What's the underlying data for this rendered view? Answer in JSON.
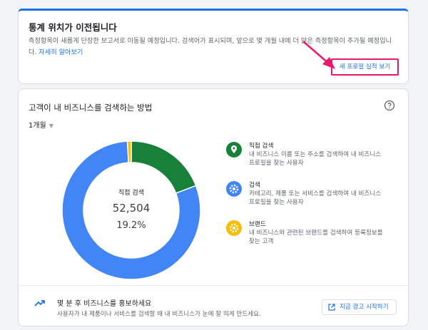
{
  "notice": {
    "title": "통계 위치가 이전됩니다",
    "body": "측정항목이 새롭게 단장한 보고서로 이동될 예정입니다. 검색어가 표시되며, 앞으로 몇 개월 내에 더 많은 측정항목이 추가될 예정입니다.",
    "link": "자세히 알아보기",
    "button": "새 프로필 실적 보기"
  },
  "main": {
    "title": "고객이 내 비즈니스를 검색하는 방법",
    "period": "1개월",
    "center": {
      "label": "직접 검색",
      "count": "52,504",
      "percent": "19.2%"
    },
    "legend": [
      {
        "title": "직접 검색",
        "desc": "내 비즈니스 이름 또는 주소를 검색하여 내 비즈니스 프로필을 찾는 사용자",
        "color": "#188038",
        "icon": "location-pin-icon"
      },
      {
        "title": "검색",
        "desc": "카테고리, 제품 또는 서비스를 검색하여 내 비즈니스 프로필을 찾는 사용자",
        "color": "#4285f4",
        "icon": "search-gear-icon"
      },
      {
        "title": "브랜드",
        "desc": "내 비즈니스와 관련된 브랜드를 검색하여 등록정보를 찾는 고객",
        "color": "#fbbc04",
        "icon": "brand-gear-icon"
      }
    ]
  },
  "chart_data": {
    "type": "pie",
    "categories": [
      "직접 검색",
      "검색",
      "브랜드"
    ],
    "values": [
      19.2,
      79.9,
      0.9
    ],
    "colors": [
      "#188038",
      "#4285f4",
      "#fbbc04"
    ]
  },
  "promo": {
    "title": "몇 분 후 비즈니스를 홍보하세요",
    "desc": "사용자가 내 제품이나 서비스를 검색할 때 내 비즈니스가 눈에 잘 띄게 만드세요.",
    "button": "지금 광고 시작하기"
  }
}
